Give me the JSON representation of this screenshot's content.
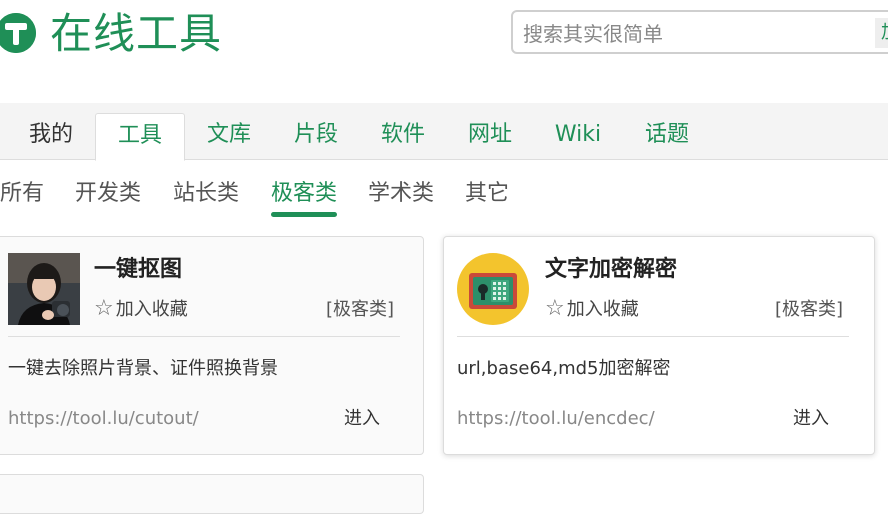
{
  "header": {
    "logo_icon": "tool-hammer-logo-icon",
    "logo_text": "在线工具",
    "search_placeholder": "搜索其实很简单",
    "search_button_label": "加"
  },
  "colors": {
    "accent": "#1f8f57",
    "nav_bg": "#f4f4f4"
  },
  "nav": {
    "items": [
      {
        "label": "我的"
      },
      {
        "label": "工具"
      },
      {
        "label": "文库"
      },
      {
        "label": "片段"
      },
      {
        "label": "软件"
      },
      {
        "label": "网址"
      },
      {
        "label": "Wiki"
      },
      {
        "label": "话题"
      }
    ],
    "active": "工具"
  },
  "subnav": {
    "items": [
      {
        "label": "所有"
      },
      {
        "label": "开发类"
      },
      {
        "label": "站长类"
      },
      {
        "label": "极客类"
      },
      {
        "label": "学术类"
      },
      {
        "label": "其它"
      }
    ],
    "active": "极客类"
  },
  "cards": [
    {
      "title": "一键抠图",
      "fav_label": "加入收藏",
      "tag": "[极客类]",
      "description": "一键去除照片背景、证件照换背景",
      "url": "https://tool.lu/cutout/",
      "enter_label": "进入",
      "icon": "portrait-photo-thumbnail"
    },
    {
      "title": "文字加密解密",
      "fav_label": "加入收藏",
      "tag": "[极客类]",
      "description": "url,base64,md5加密解密",
      "url": "https://tool.lu/encdec/",
      "enter_label": "进入",
      "icon": "safe-lock-icon"
    }
  ]
}
